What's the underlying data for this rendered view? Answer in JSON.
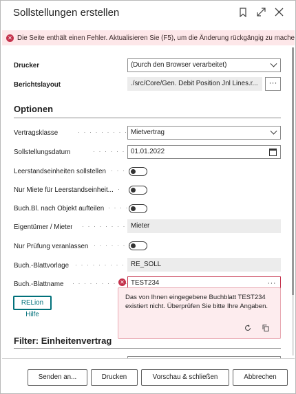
{
  "dialog": {
    "title": "Sollstellungen erstellen",
    "icons": [
      "bookmark-icon",
      "expand-icon",
      "close-icon"
    ]
  },
  "error_bar": {
    "text": "Die Seite enthält einen Fehler. Aktualisieren Sie (F5), um die Änderung rückgängig zu machen o..."
  },
  "general": {
    "drucker_label": "Drucker",
    "drucker_value": "(Durch den Browser verarbeitet)",
    "berichtslayout_label": "Berichtslayout",
    "berichtslayout_value": "./src/Core/Gen. Debit Position Jnl Lines.r...",
    "ellipsis": "···"
  },
  "optionen": {
    "heading": "Optionen",
    "vertragsklasse_label": "Vertragsklasse",
    "vertragsklasse_value": "Mietvertrag",
    "datum_label": "Sollstellungsdatum",
    "datum_value": "01.01.2022",
    "leerstand_label": "Leerstandseinheiten sollstellen",
    "nur_miete_label": "Nur Miete für Leerstandseinheit...",
    "buchbl_label": "Buch.Bl. nach Objekt aufteilen",
    "eigentuemer_label": "Eigentümer / Mieter",
    "eigentuemer_value": "Mieter",
    "pruefung_label": "Nur Prüfung veranlassen",
    "vorlage_label": "Buch.-Blattvorlage",
    "vorlage_value": "RE_SOLL",
    "blattname_label": "Buch.-Blattname",
    "blattname_value": "TEST234",
    "help_label": "RELion Hilfe",
    "toggles": {
      "leerstand": false,
      "nur_miete": false,
      "buchbl": false,
      "pruefung": false
    }
  },
  "tooltip": {
    "text": "Das von Ihnen eingegebene Buchblatt TEST234 existiert nicht. Überprüfen Sie bitte Ihre Angaben."
  },
  "filter": {
    "heading": "Filter: Einheitenvertrag"
  },
  "footer": {
    "send_label": "Senden an...",
    "print_label": "Drucken",
    "preview_label": "Vorschau & schließen",
    "cancel_label": "Abbrechen"
  },
  "colors": {
    "error": "#c4314b",
    "error_bg": "#fde7e9",
    "accent": "#00707a"
  }
}
